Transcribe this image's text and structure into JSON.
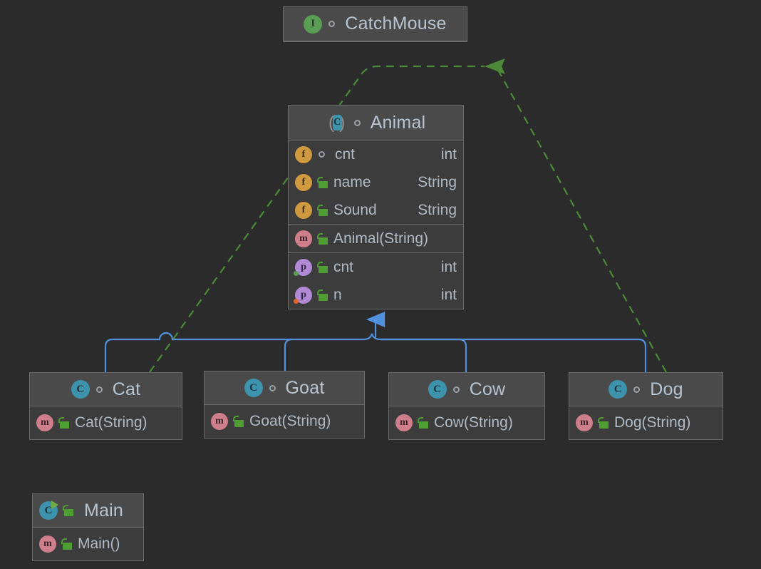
{
  "diagram": {
    "kind": "uml-class-diagram",
    "background": "#2b2b2b",
    "colors": {
      "box_body": "#3c3c3c",
      "box_header": "#4a4a4a",
      "box_border": "#6b6b6b",
      "text": "#b0bac4",
      "inheritance_edge": "#5090dd",
      "realization_edge": "#5a8a3a",
      "interface_icon": "#5a9e55",
      "class_icon": "#3d93ab",
      "field_icon": "#cf9a3f",
      "method_icon": "#cf7f8c",
      "property_icon": "#b08ad4",
      "lock_icon": "#4f9e33"
    }
  },
  "classes": {
    "catchmouse": {
      "name": "CatchMouse",
      "stereotype_icon": "interface-icon",
      "visibility_icon": "public-circle-icon",
      "sections": []
    },
    "animal": {
      "name": "Animal",
      "stereotype_icon": "abstract-class-icon",
      "visibility_icon": "public-circle-icon",
      "sections": [
        {
          "name": "fields",
          "rows": [
            {
              "icon": "field-icon",
              "visibility_icon": "public-circle-icon",
              "member": "cnt",
              "type": "int"
            },
            {
              "icon": "field-icon",
              "visibility_icon": "package-lock-icon",
              "member": "name",
              "type": "String"
            },
            {
              "icon": "field-icon",
              "visibility_icon": "package-lock-icon",
              "member": "Sound",
              "type": "String"
            }
          ]
        },
        {
          "name": "constructors",
          "rows": [
            {
              "icon": "method-icon",
              "visibility_icon": "package-lock-icon",
              "member": "Animal(String)",
              "type": ""
            }
          ]
        },
        {
          "name": "properties",
          "rows": [
            {
              "icon": "property-icon",
              "visibility_icon": "package-lock-icon",
              "member": "cnt",
              "type": "int",
              "accessor_badge": "getter-dot"
            },
            {
              "icon": "property-icon",
              "visibility_icon": "package-lock-icon",
              "member": "n",
              "type": "int",
              "accessor_badge": "setter-dot"
            }
          ]
        }
      ]
    },
    "cat": {
      "name": "Cat",
      "stereotype_icon": "class-icon",
      "visibility_icon": "public-circle-icon",
      "sections": [
        {
          "name": "constructors",
          "rows": [
            {
              "icon": "method-icon",
              "visibility_icon": "package-lock-icon",
              "member": "Cat(String)",
              "type": ""
            }
          ]
        }
      ]
    },
    "goat": {
      "name": "Goat",
      "stereotype_icon": "class-icon",
      "visibility_icon": "public-circle-icon",
      "sections": [
        {
          "name": "constructors",
          "rows": [
            {
              "icon": "method-icon",
              "visibility_icon": "package-lock-icon",
              "member": "Goat(String)",
              "type": ""
            }
          ]
        }
      ]
    },
    "cow": {
      "name": "Cow",
      "stereotype_icon": "class-icon",
      "visibility_icon": "public-circle-icon",
      "sections": [
        {
          "name": "constructors",
          "rows": [
            {
              "icon": "method-icon",
              "visibility_icon": "package-lock-icon",
              "member": "Cow(String)",
              "type": ""
            }
          ]
        }
      ]
    },
    "dog": {
      "name": "Dog",
      "stereotype_icon": "class-icon",
      "visibility_icon": "public-circle-icon",
      "sections": [
        {
          "name": "constructors",
          "rows": [
            {
              "icon": "method-icon",
              "visibility_icon": "package-lock-icon",
              "member": "Dog(String)",
              "type": ""
            }
          ]
        }
      ]
    },
    "main": {
      "name": "Main",
      "stereotype_icon": "runnable-class-icon",
      "visibility_icon": "package-lock-icon",
      "sections": [
        {
          "name": "constructors",
          "rows": [
            {
              "icon": "method-icon",
              "visibility_icon": "package-lock-icon",
              "member": "Main()",
              "type": ""
            }
          ]
        }
      ]
    }
  },
  "relations": [
    {
      "from": "Cat",
      "to": "Animal",
      "type": "inheritance"
    },
    {
      "from": "Goat",
      "to": "Animal",
      "type": "inheritance"
    },
    {
      "from": "Cow",
      "to": "Animal",
      "type": "inheritance"
    },
    {
      "from": "Dog",
      "to": "Animal",
      "type": "inheritance"
    },
    {
      "from": "Cat",
      "to": "CatchMouse",
      "type": "realization"
    },
    {
      "from": "Dog",
      "to": "CatchMouse",
      "type": "realization"
    }
  ]
}
